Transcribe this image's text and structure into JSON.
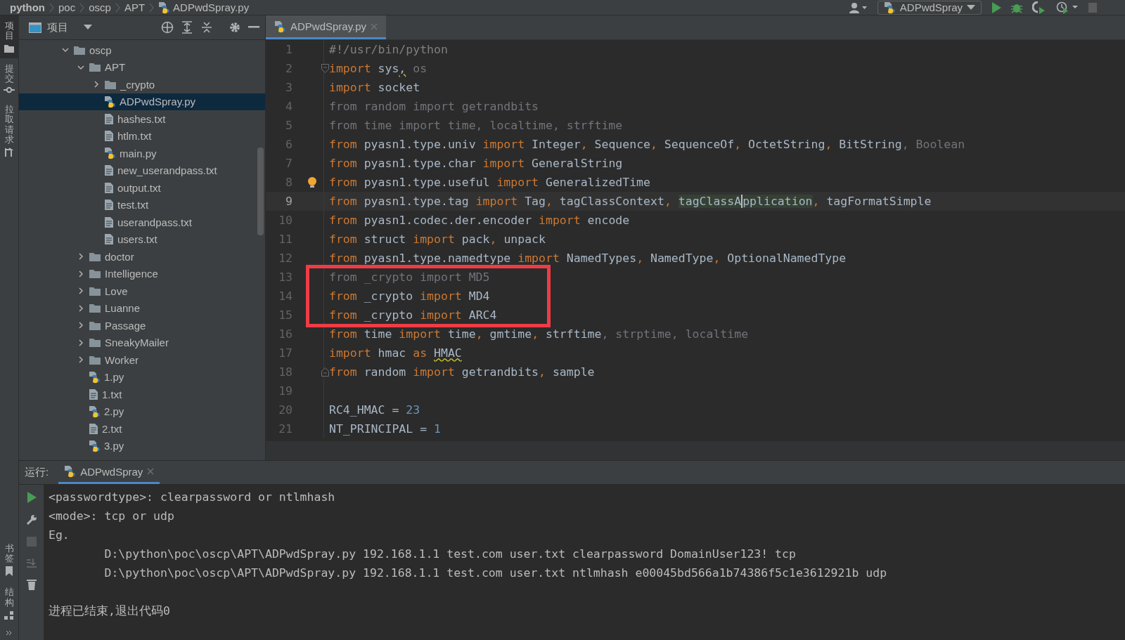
{
  "breadcrumb": [
    {
      "label": "python",
      "kind": "folder"
    },
    {
      "label": "poc",
      "kind": "folder"
    },
    {
      "label": "oscp",
      "kind": "folder"
    },
    {
      "label": "APT",
      "kind": "folder"
    },
    {
      "label": "ADPwdSpray.py",
      "kind": "python"
    }
  ],
  "toolbar": {
    "run_config": "ADPwdSpray"
  },
  "tool_strip": {
    "top": [
      {
        "label": "项目",
        "kind": "project",
        "selected": true
      },
      {
        "label": "提交",
        "kind": "commit",
        "selected": false
      },
      {
        "label": "拉取请求",
        "kind": "pull",
        "selected": false
      }
    ],
    "bottom": [
      {
        "label": "书签",
        "kind": "bookmarks",
        "selected": false
      },
      {
        "label": "结构",
        "kind": "structure",
        "selected": false
      }
    ]
  },
  "project": {
    "title": "项目",
    "tree": [
      {
        "name": "oscp",
        "kind": "folder",
        "expanded": true,
        "selected": false,
        "children": [
          {
            "name": "APT",
            "kind": "folder",
            "expanded": true,
            "selected": false,
            "children": [
              {
                "name": "_crypto",
                "kind": "folder",
                "expanded": false,
                "selected": false
              },
              {
                "name": "ADPwdSpray.py",
                "kind": "python",
                "selected": true
              },
              {
                "name": "hashes.txt",
                "kind": "text",
                "selected": false
              },
              {
                "name": "htlm.txt",
                "kind": "text",
                "selected": false
              },
              {
                "name": "main.py",
                "kind": "python",
                "selected": false
              },
              {
                "name": "new_userandpass.txt",
                "kind": "text",
                "selected": false
              },
              {
                "name": "output.txt",
                "kind": "text",
                "selected": false
              },
              {
                "name": "test.txt",
                "kind": "text",
                "selected": false
              },
              {
                "name": "userandpass.txt",
                "kind": "text",
                "selected": false
              },
              {
                "name": "users.txt",
                "kind": "text",
                "selected": false
              }
            ]
          },
          {
            "name": "doctor",
            "kind": "folder",
            "expanded": false,
            "selected": false
          },
          {
            "name": "Intelligence",
            "kind": "folder",
            "expanded": false,
            "selected": false
          },
          {
            "name": "Love",
            "kind": "folder",
            "expanded": false,
            "selected": false
          },
          {
            "name": "Luanne",
            "kind": "folder",
            "expanded": false,
            "selected": false
          },
          {
            "name": "Passage",
            "kind": "folder",
            "expanded": false,
            "selected": false
          },
          {
            "name": "SneakyMailer",
            "kind": "folder",
            "expanded": false,
            "selected": false
          },
          {
            "name": "Worker",
            "kind": "folder",
            "expanded": false,
            "selected": false
          },
          {
            "name": "1.py",
            "kind": "python",
            "selected": false
          },
          {
            "name": "1.txt",
            "kind": "text",
            "selected": false
          },
          {
            "name": "2.py",
            "kind": "python",
            "selected": false
          },
          {
            "name": "2.txt",
            "kind": "text",
            "selected": false
          },
          {
            "name": "3.py",
            "kind": "python",
            "selected": false
          }
        ]
      }
    ]
  },
  "editor": {
    "tabs": [
      {
        "label": "ADPwdSpray.py",
        "kind": "python",
        "selected": true
      }
    ],
    "lines": [
      {
        "number": "1",
        "current": false,
        "framed": false,
        "tokens": [
          {
            "text": "#!/usr/bin/python",
            "kind": "comment"
          }
        ]
      },
      {
        "number": "2",
        "current": false,
        "framed": false,
        "fold_start": true,
        "tokens": [
          {
            "text": "import",
            "kind": "kw"
          },
          {
            "text": " sys",
            "kind": "plain"
          },
          {
            "text": ",",
            "kind": "warn"
          },
          {
            "text": " os",
            "kind": "unused"
          }
        ]
      },
      {
        "number": "3",
        "current": false,
        "framed": false,
        "tokens": [
          {
            "text": "import",
            "kind": "kw"
          },
          {
            "text": " socket",
            "kind": "plain"
          }
        ]
      },
      {
        "number": "4",
        "current": false,
        "framed": false,
        "tokens": [
          {
            "text": "from random import getrandbits",
            "kind": "unused"
          }
        ]
      },
      {
        "number": "5",
        "current": false,
        "framed": false,
        "tokens": [
          {
            "text": "from time import time, localtime, strftime",
            "kind": "unused"
          }
        ]
      },
      {
        "number": "6",
        "current": false,
        "framed": false,
        "tokens": [
          {
            "text": "from",
            "kind": "kw"
          },
          {
            "text": " pyasn1.type.univ ",
            "kind": "plain"
          },
          {
            "text": "import",
            "kind": "kw"
          },
          {
            "text": " Integer",
            "kind": "plain"
          },
          {
            "text": ",",
            "kind": "kw"
          },
          {
            "text": " Sequence",
            "kind": "plain"
          },
          {
            "text": ",",
            "kind": "kw"
          },
          {
            "text": " SequenceOf",
            "kind": "plain"
          },
          {
            "text": ",",
            "kind": "kw"
          },
          {
            "text": " OctetString",
            "kind": "plain"
          },
          {
            "text": ",",
            "kind": "kw"
          },
          {
            "text": " BitString",
            "kind": "plain"
          },
          {
            "text": ", Boolean",
            "kind": "unused"
          }
        ]
      },
      {
        "number": "7",
        "current": false,
        "framed": false,
        "tokens": [
          {
            "text": "from",
            "kind": "kw"
          },
          {
            "text": " pyasn1.type.char ",
            "kind": "plain"
          },
          {
            "text": "import",
            "kind": "kw"
          },
          {
            "text": " GeneralString",
            "kind": "plain"
          }
        ]
      },
      {
        "number": "8",
        "current": false,
        "framed": false,
        "bulb": true,
        "tokens": [
          {
            "text": "from",
            "kind": "kw"
          },
          {
            "text": " pyasn1.type.useful ",
            "kind": "plain"
          },
          {
            "text": "import",
            "kind": "kw"
          },
          {
            "text": " GeneralizedTime",
            "kind": "plain"
          }
        ]
      },
      {
        "number": "9",
        "current": true,
        "framed": false,
        "tokens": [
          {
            "text": "from",
            "kind": "kw"
          },
          {
            "text": " pyasn1.type.tag ",
            "kind": "plain"
          },
          {
            "text": "import",
            "kind": "kw"
          },
          {
            "text": " Tag",
            "kind": "plain"
          },
          {
            "text": ",",
            "kind": "kw"
          },
          {
            "text": " tagClassContext",
            "kind": "plain"
          },
          {
            "text": ", ",
            "kind": "kw"
          },
          {
            "text": "tagClassA",
            "kind": "highlight"
          },
          {
            "text": "pplication",
            "kind": "caret"
          },
          {
            "text": ",",
            "kind": "kw"
          },
          {
            "text": " tagFormatSimple",
            "kind": "plain"
          }
        ]
      },
      {
        "number": "10",
        "current": false,
        "framed": false,
        "tokens": [
          {
            "text": "from",
            "kind": "kw"
          },
          {
            "text": " pyasn1.codec.der.encoder ",
            "kind": "plain"
          },
          {
            "text": "import",
            "kind": "kw"
          },
          {
            "text": " encode",
            "kind": "plain"
          }
        ]
      },
      {
        "number": "11",
        "current": false,
        "framed": false,
        "tokens": [
          {
            "text": "from",
            "kind": "kw"
          },
          {
            "text": " struct ",
            "kind": "plain"
          },
          {
            "text": "import",
            "kind": "kw"
          },
          {
            "text": " pack",
            "kind": "plain"
          },
          {
            "text": ",",
            "kind": "kw"
          },
          {
            "text": " unpack",
            "kind": "plain"
          }
        ]
      },
      {
        "number": "12",
        "current": false,
        "framed": false,
        "tokens": [
          {
            "text": "from",
            "kind": "kw"
          },
          {
            "text": " pyasn1.type.namedtype ",
            "kind": "plain"
          },
          {
            "text": "import",
            "kind": "kw"
          },
          {
            "text": " NamedTypes",
            "kind": "plain"
          },
          {
            "text": ",",
            "kind": "kw"
          },
          {
            "text": " NamedType",
            "kind": "plain"
          },
          {
            "text": ",",
            "kind": "kw"
          },
          {
            "text": " OptionalNamedType",
            "kind": "plain"
          }
        ]
      },
      {
        "number": "13",
        "current": false,
        "framed": true,
        "tokens": [
          {
            "text": "from _crypto import MD5",
            "kind": "unused"
          }
        ]
      },
      {
        "number": "14",
        "current": false,
        "framed": true,
        "tokens": [
          {
            "text": "from",
            "kind": "kw"
          },
          {
            "text": " _crypto ",
            "kind": "plain"
          },
          {
            "text": "import",
            "kind": "kw"
          },
          {
            "text": " MD4",
            "kind": "plain"
          }
        ]
      },
      {
        "number": "15",
        "current": false,
        "framed": true,
        "tokens": [
          {
            "text": "from",
            "kind": "kw"
          },
          {
            "text": " _crypto ",
            "kind": "plain"
          },
          {
            "text": "import",
            "kind": "kw"
          },
          {
            "text": " ARC4",
            "kind": "plain"
          }
        ]
      },
      {
        "number": "16",
        "current": false,
        "framed": false,
        "tokens": [
          {
            "text": "from",
            "kind": "kw"
          },
          {
            "text": " time ",
            "kind": "plain"
          },
          {
            "text": "import",
            "kind": "kw"
          },
          {
            "text": " time",
            "kind": "plain"
          },
          {
            "text": ",",
            "kind": "kw"
          },
          {
            "text": " gmtime",
            "kind": "plain"
          },
          {
            "text": ",",
            "kind": "kw"
          },
          {
            "text": " strftime",
            "kind": "plain"
          },
          {
            "text": ", strptime, localtime",
            "kind": "unused"
          }
        ]
      },
      {
        "number": "17",
        "current": false,
        "framed": false,
        "tokens": [
          {
            "text": "import",
            "kind": "kw"
          },
          {
            "text": " hmac ",
            "kind": "plain"
          },
          {
            "text": "as ",
            "kind": "kw"
          },
          {
            "text": "HMAC",
            "kind": "warn"
          }
        ]
      },
      {
        "number": "18",
        "current": false,
        "framed": false,
        "fold_end": true,
        "tokens": [
          {
            "text": "from",
            "kind": "kw"
          },
          {
            "text": " random ",
            "kind": "plain"
          },
          {
            "text": "import",
            "kind": "kw"
          },
          {
            "text": " getrandbits",
            "kind": "plain"
          },
          {
            "text": ",",
            "kind": "kw"
          },
          {
            "text": " sample",
            "kind": "plain"
          }
        ]
      },
      {
        "number": "19",
        "current": false,
        "framed": false
      },
      {
        "number": "20",
        "current": false,
        "framed": false,
        "tokens": [
          {
            "text": "RC4_HMAC = ",
            "kind": "plain"
          },
          {
            "text": "23",
            "kind": "num"
          }
        ]
      },
      {
        "number": "21",
        "current": false,
        "framed": false,
        "tokens": [
          {
            "text": "NT_PRINCIPAL = ",
            "kind": "plain"
          },
          {
            "text": "1",
            "kind": "num"
          }
        ]
      }
    ]
  },
  "run": {
    "label": "运行:",
    "tabs": [
      {
        "label": "ADPwdSpray",
        "kind": "python",
        "selected": true
      }
    ],
    "output": [
      "<passwordtype>: clearpassword or ntlmhash",
      "<mode>: tcp or udp",
      "Eg.",
      "        D:\\python\\poc\\oscp\\APT\\ADPwdSpray.py 192.168.1.1 test.com user.txt clearpassword DomainUser123! tcp",
      "        D:\\python\\poc\\oscp\\APT\\ADPwdSpray.py 192.168.1.1 test.com user.txt ntlmhash e00045bd566a1b74386f5c1e3612921b udp"
    ],
    "exit_message": "进程已结束,退出代码0"
  }
}
